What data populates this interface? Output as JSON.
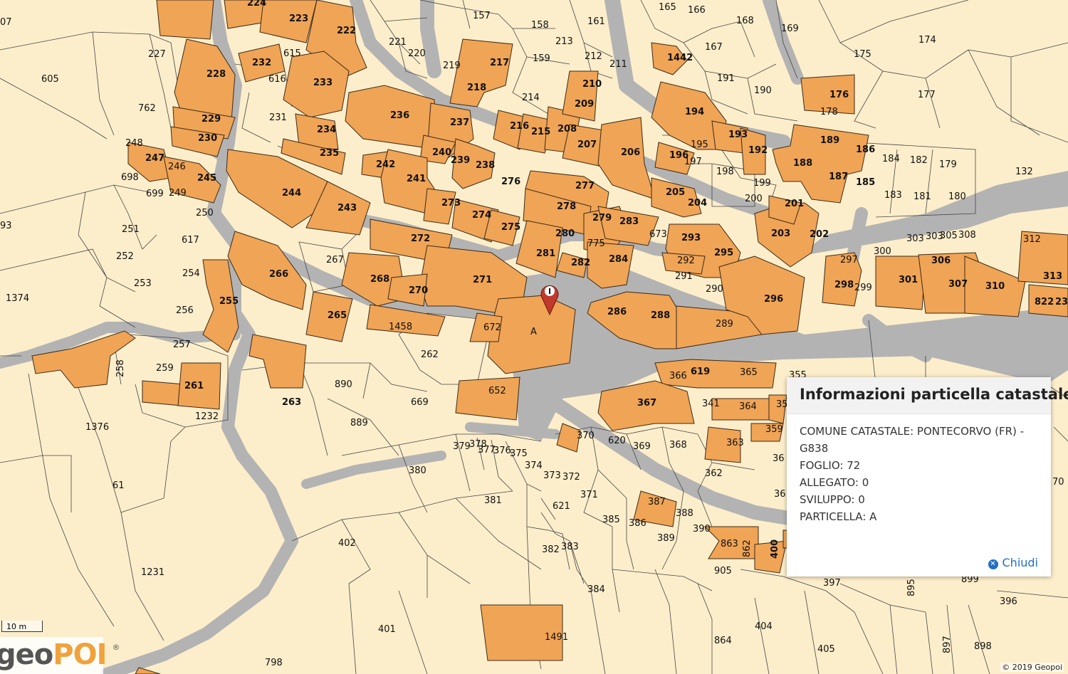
{
  "popup": {
    "title": "Informazioni particella catastale",
    "comune": "COMUNE CATASTALE: PONTECORVO (FR) -",
    "comune_code": "G838",
    "foglio": "FOGLIO: 72",
    "allegato": "ALLEGATO: 0",
    "sviluppo": "SVILUPPO: 0",
    "particella": "PARTICELLA: A",
    "close_label": "Chiudi",
    "close_icon": "close-circle-icon"
  },
  "map": {
    "marker_letter": "I",
    "marker_icon": "map-pin-icon",
    "building_color": "#f0a455",
    "land_color": "#fdeecb",
    "road_color": "#b3b3b3",
    "labels": [
      "07",
      "224",
      "223",
      "222",
      "157",
      "165",
      "166",
      "168",
      "169",
      "227",
      "615",
      "232",
      "221",
      "220",
      "158",
      "161",
      "213",
      "174",
      "175",
      "605",
      "228",
      "616",
      "233",
      "219",
      "159",
      "212",
      "211",
      "1442",
      "167",
      "217",
      "210",
      "191",
      "190",
      "176",
      "177",
      "762",
      "236",
      "237",
      "218",
      "214",
      "209",
      "194",
      "178",
      "229",
      "231",
      "234",
      "216",
      "215",
      "208",
      "193",
      "189",
      "186",
      "230",
      "240",
      "239",
      "207",
      "206",
      "195",
      "192",
      "248",
      "247",
      "246",
      "235",
      "238",
      "196",
      "197",
      "198",
      "184",
      "182",
      "179",
      "132",
      "698",
      "245",
      "242",
      "241",
      "276",
      "277",
      "188",
      "187",
      "185",
      "699",
      "249",
      "244",
      "243",
      "273",
      "278",
      "279",
      "205",
      "204",
      "199",
      "200",
      "201",
      "183",
      "181",
      "180",
      "250",
      "274",
      "275",
      "283",
      "673",
      "203",
      "202",
      "93",
      "251",
      "617",
      "272",
      "280",
      "281",
      "775",
      "293",
      "303",
      "303",
      "305",
      "308",
      "312",
      "252",
      "267",
      "282",
      "284",
      "292",
      "295",
      "300",
      "297",
      "1374",
      "253",
      "254",
      "266",
      "268",
      "270",
      "271",
      "291",
      "290",
      "298",
      "299",
      "301",
      "306",
      "307",
      "310",
      "313",
      "255",
      "256",
      "265",
      "286",
      "288",
      "296",
      "822",
      "231",
      "1458",
      "289",
      "257",
      "672",
      "A",
      "262",
      "259",
      "261",
      "258",
      "263",
      "890",
      "669",
      "652",
      "366",
      "619",
      "365",
      "355",
      "1232",
      "889",
      "341",
      "364",
      "367",
      "35",
      "1376",
      "379",
      "378",
      "377",
      "376",
      "375",
      "370",
      "620",
      "369",
      "368",
      "363",
      "359",
      "36",
      "380",
      "374",
      "373",
      "372",
      "362",
      "61",
      "381",
      "371",
      "621",
      "385",
      "387",
      "386",
      "388",
      "389",
      "390",
      "36",
      "70",
      "402",
      "382",
      "383",
      "863",
      "862",
      "400",
      "905",
      "1231",
      "384",
      "397",
      "895",
      "899",
      "396",
      "401",
      "1491",
      "404",
      "864",
      "897",
      "898",
      "405",
      "798",
      "10 m"
    ],
    "scale_label": "10 m",
    "logo_part1": "geo",
    "logo_part2": "POI",
    "logo_reg": "®",
    "copyright": "© 2019 Geopoi"
  }
}
